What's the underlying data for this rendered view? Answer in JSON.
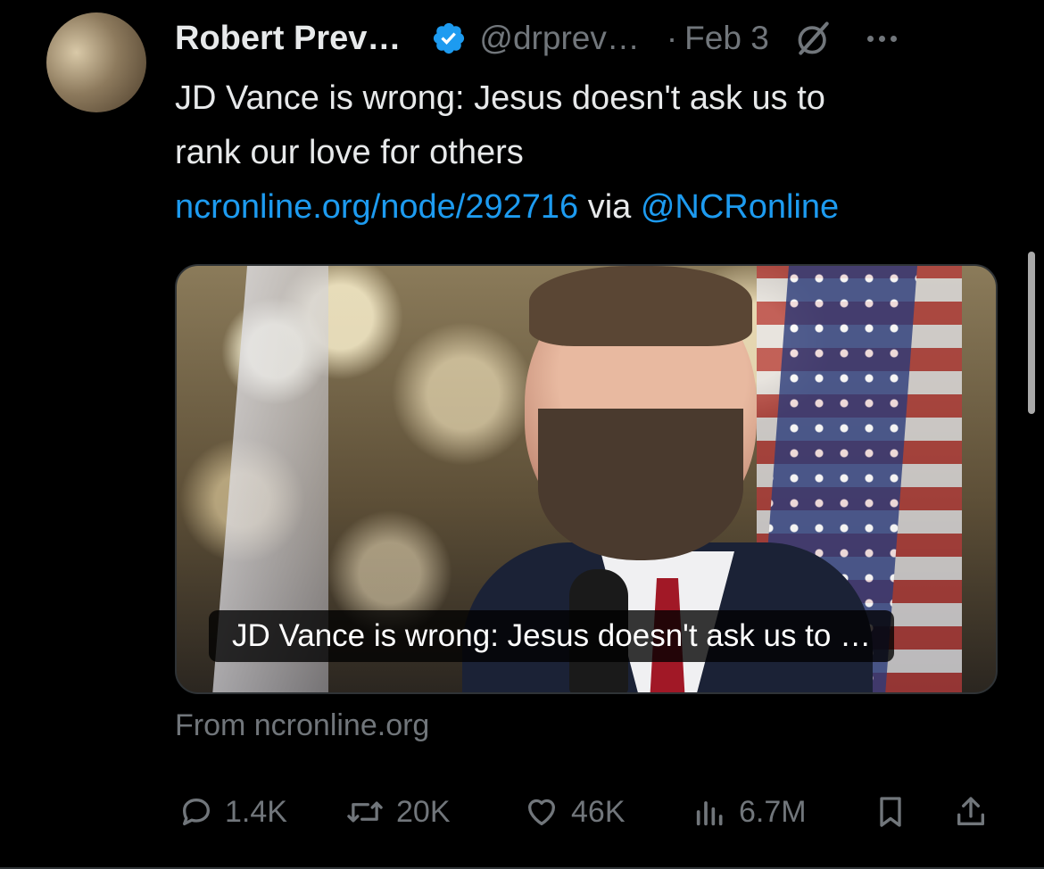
{
  "tweet": {
    "author_name": "Robert Prev…",
    "handle": "@drprev…",
    "separator": "·",
    "date": "Feb 3",
    "body_line1": "JD Vance is wrong: Jesus doesn't ask us to",
    "body_line2": "rank our love for others",
    "link": "ncronline.org/node/292716",
    "via": " via ",
    "mention": "@NCRonline",
    "card_title": "JD Vance is wrong: Jesus doesn't ask us to …",
    "card_source": "From ncronline.org"
  },
  "actions": {
    "replies": "1.4K",
    "reposts": "20K",
    "likes": "46K",
    "views": "6.7M"
  },
  "icons": {
    "verified": "verified-badge-icon",
    "grok": "grok-icon",
    "more": "more-icon",
    "reply": "reply-icon",
    "repost": "repost-icon",
    "like": "like-icon",
    "views": "views-icon",
    "bookmark": "bookmark-icon",
    "share": "share-icon"
  },
  "colors": {
    "background": "#000000",
    "text": "#e7e9ea",
    "secondary": "#71767b",
    "link": "#1d9bf0"
  }
}
